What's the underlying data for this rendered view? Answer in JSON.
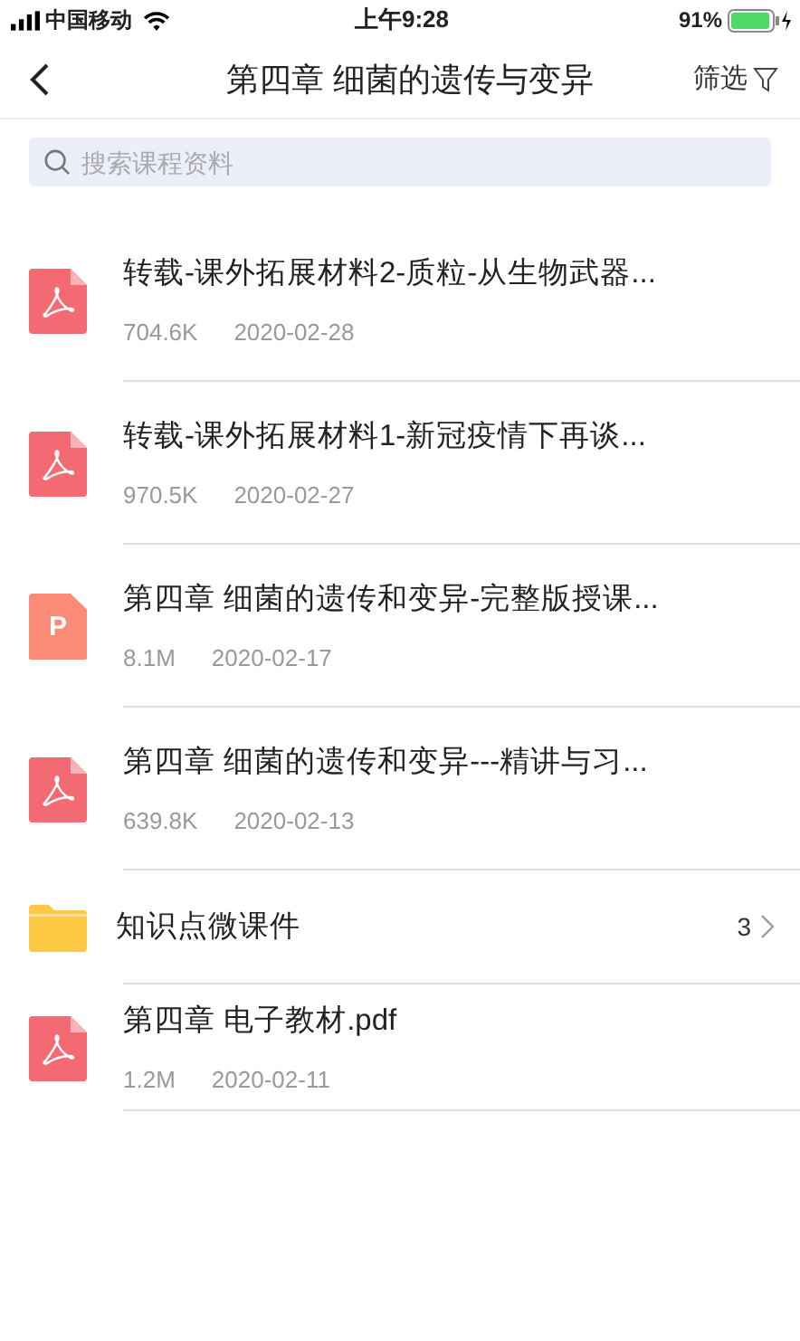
{
  "status_bar": {
    "carrier": "中国移动",
    "time": "上午9:28",
    "battery": "91%"
  },
  "nav": {
    "title": "第四章 细菌的遗传与变异",
    "filter": "筛选"
  },
  "search": {
    "placeholder": "搜索课程资料"
  },
  "files": [
    {
      "kind": "pdf",
      "name": "转载-课外拓展材料2-质粒-从生物武器...",
      "size": "704.6K",
      "date": "2020-02-28"
    },
    {
      "kind": "pdf",
      "name": "转载-课外拓展材料1-新冠疫情下再谈...",
      "size": "970.5K",
      "date": "2020-02-27"
    },
    {
      "kind": "ppt",
      "badge": "P",
      "name": "第四章  细菌的遗传和变异-完整版授课...",
      "size": "8.1M",
      "date": "2020-02-17"
    },
    {
      "kind": "pdf",
      "name": "第四章  细菌的遗传和变异---精讲与习...",
      "size": "639.8K",
      "date": "2020-02-13"
    },
    {
      "kind": "folder",
      "name": "知识点微课件",
      "count": "3"
    },
    {
      "kind": "pdf",
      "name": "第四章 电子教材.pdf",
      "size": "1.2M",
      "date": "2020-02-11"
    }
  ]
}
